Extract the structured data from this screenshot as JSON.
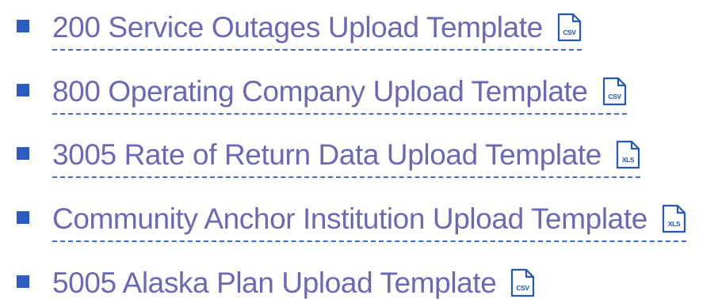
{
  "templates": [
    {
      "label": "200 Service Outages Upload Template",
      "file_type": "CSV",
      "icon": "csv-file-icon"
    },
    {
      "label": "800 Operating Company Upload Template",
      "file_type": "CSV",
      "icon": "csv-file-icon"
    },
    {
      "label": "3005 Rate of Return Data Upload Template",
      "file_type": "XLS",
      "icon": "xls-file-icon"
    },
    {
      "label": "Community Anchor Institution Upload Template",
      "file_type": "XLS",
      "icon": "xls-file-icon"
    },
    {
      "label": "5005 Alaska Plan Upload Template",
      "file_type": "CSV",
      "icon": "csv-file-icon"
    }
  ],
  "colors": {
    "link_text": "#6b69b3",
    "bullet": "#2d5bc1",
    "underline": "#3f6dbe",
    "icon": "#2457b8",
    "background": "#ffffff"
  }
}
